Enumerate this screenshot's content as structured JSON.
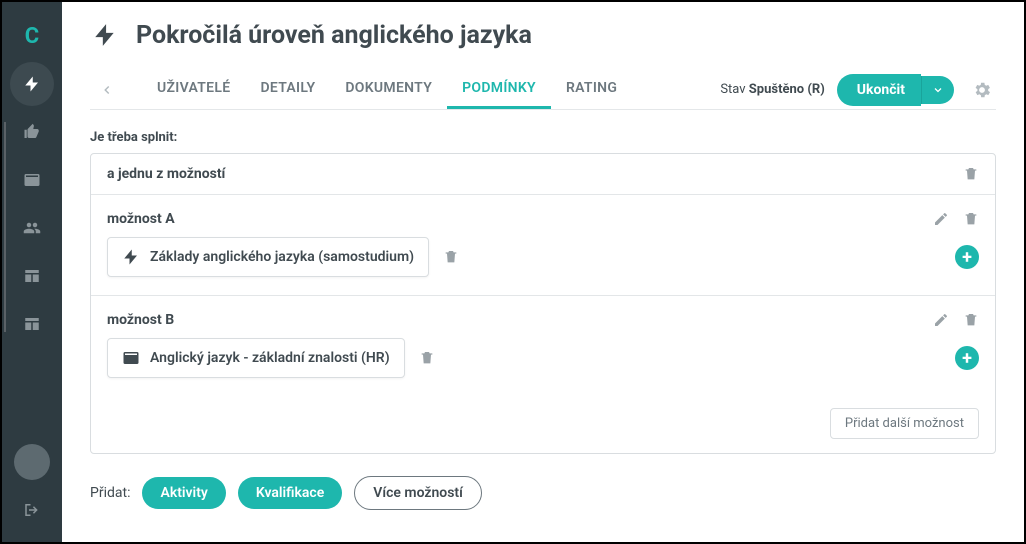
{
  "page": {
    "title": "Pokročilá úroveň anglického jazyka"
  },
  "tabs": {
    "users": "UŽIVATELÉ",
    "details": "DETAILY",
    "documents": "DOKUMENTY",
    "conditions": "PODMÍNKY",
    "rating": "RATING"
  },
  "status": {
    "label": "Stav",
    "value": "Spuštěno (R)"
  },
  "actions": {
    "end": "Ukončit"
  },
  "conditions": {
    "section_label": "Je třeba splnit:",
    "group_title": "a jednu z možností",
    "options": [
      {
        "label": "možnost A",
        "item": "Základy anglického jazyka (samostudium)",
        "icon": "bolt"
      },
      {
        "label": "možnost B",
        "item": "Anglický jazyk - základní znalosti (HR)",
        "icon": "card"
      }
    ],
    "add_more": "Přidat další možnost"
  },
  "footer": {
    "label": "Přidat:",
    "activity": "Aktivity",
    "qualification": "Kvalifikace",
    "more": "Více možností"
  }
}
